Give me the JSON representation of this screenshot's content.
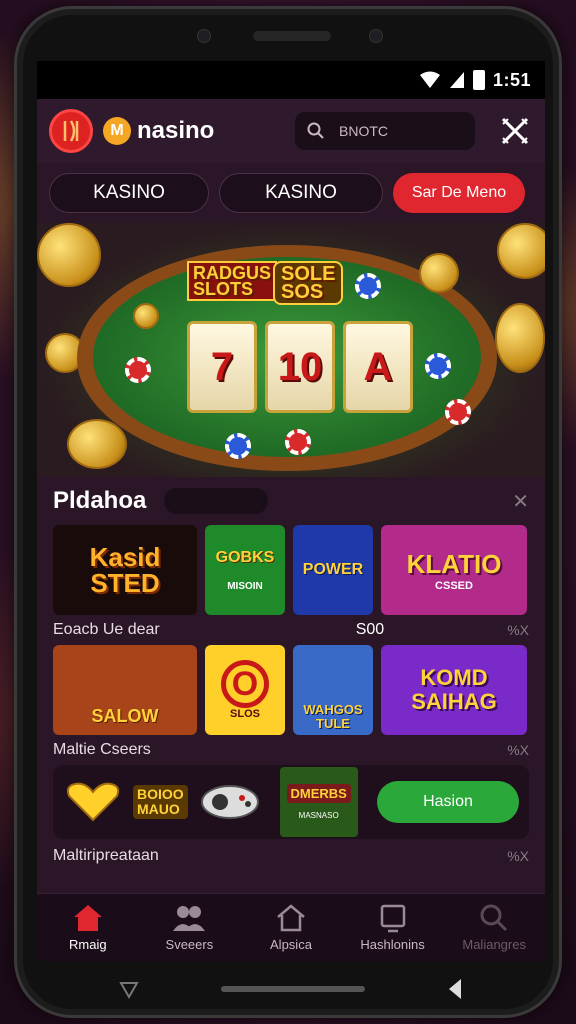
{
  "status": {
    "time": "1:51"
  },
  "header": {
    "brand": "nasino",
    "brand_badge": "M",
    "search_placeholder": "BNOTC",
    "icons": {
      "logo": "red-logo-icon",
      "search": "search-icon",
      "close": "close-x-icon"
    }
  },
  "tabs": [
    {
      "label": "KASINO"
    },
    {
      "label": "KASINO"
    },
    {
      "label": "Sar De Meno"
    }
  ],
  "hero": {
    "sign_left": "RADGUS\nSLOTS",
    "sign_right": "SOLE\nSOS",
    "reels": [
      "7",
      "10",
      "A"
    ]
  },
  "section1": {
    "title": "Pldahoa",
    "row1_tiles": [
      {
        "label": "Kasid\nSTED",
        "color": "#1a0b0b",
        "text_color": "#ffb22a"
      },
      {
        "label": "GOBKS",
        "sub": "MISOIN",
        "color": "#1f8a2a",
        "text_color": "#ffd23a"
      },
      {
        "label": "POWER",
        "color": "#1f3aa8",
        "text_color": "#ffd23a"
      },
      {
        "label": "KLATIO",
        "sub": "CSSED",
        "color": "#b22a8a",
        "text_color": "#ffd23a"
      }
    ],
    "row1_label": "Eoacb Ue dear",
    "row1_value": "S00",
    "row1_x": "%X",
    "row2_tiles": [
      {
        "label": "SALOW",
        "color": "#a8441a",
        "text_color": "#ffd23a"
      },
      {
        "label": "O",
        "sub": "SLOS",
        "color": "#ffcf2a",
        "text_color": "#c81818"
      },
      {
        "label": "WAHGOS\nTULE",
        "color": "#3a6ac8",
        "text_color": "#ffd23a"
      },
      {
        "label": "KOMD\nSAIHAG",
        "color": "#7a2ac8",
        "text_color": "#ffd23a"
      }
    ],
    "row2_label": "Maltie Cseers",
    "row2_x": "%X",
    "panel_left": "BOIOO\nMAUO",
    "panel_game": "DMERBS",
    "panel_game_sub": "MASNASO",
    "panel_button": "Hasion",
    "row3_label": "Maltiripreataan",
    "row3_x": "%X"
  },
  "nav": [
    {
      "label": "Rmaig",
      "icon": "home-red-icon"
    },
    {
      "label": "Sveeers",
      "icon": "users-icon"
    },
    {
      "label": "Alpsica",
      "icon": "house-icon"
    },
    {
      "label": "Hashlonins",
      "icon": "tablet-icon"
    },
    {
      "label": "Maliangres",
      "icon": "search-icon"
    }
  ],
  "colors": {
    "accent": "#e0262f",
    "bg": "#2a1626",
    "green_button": "#2aa83a"
  }
}
